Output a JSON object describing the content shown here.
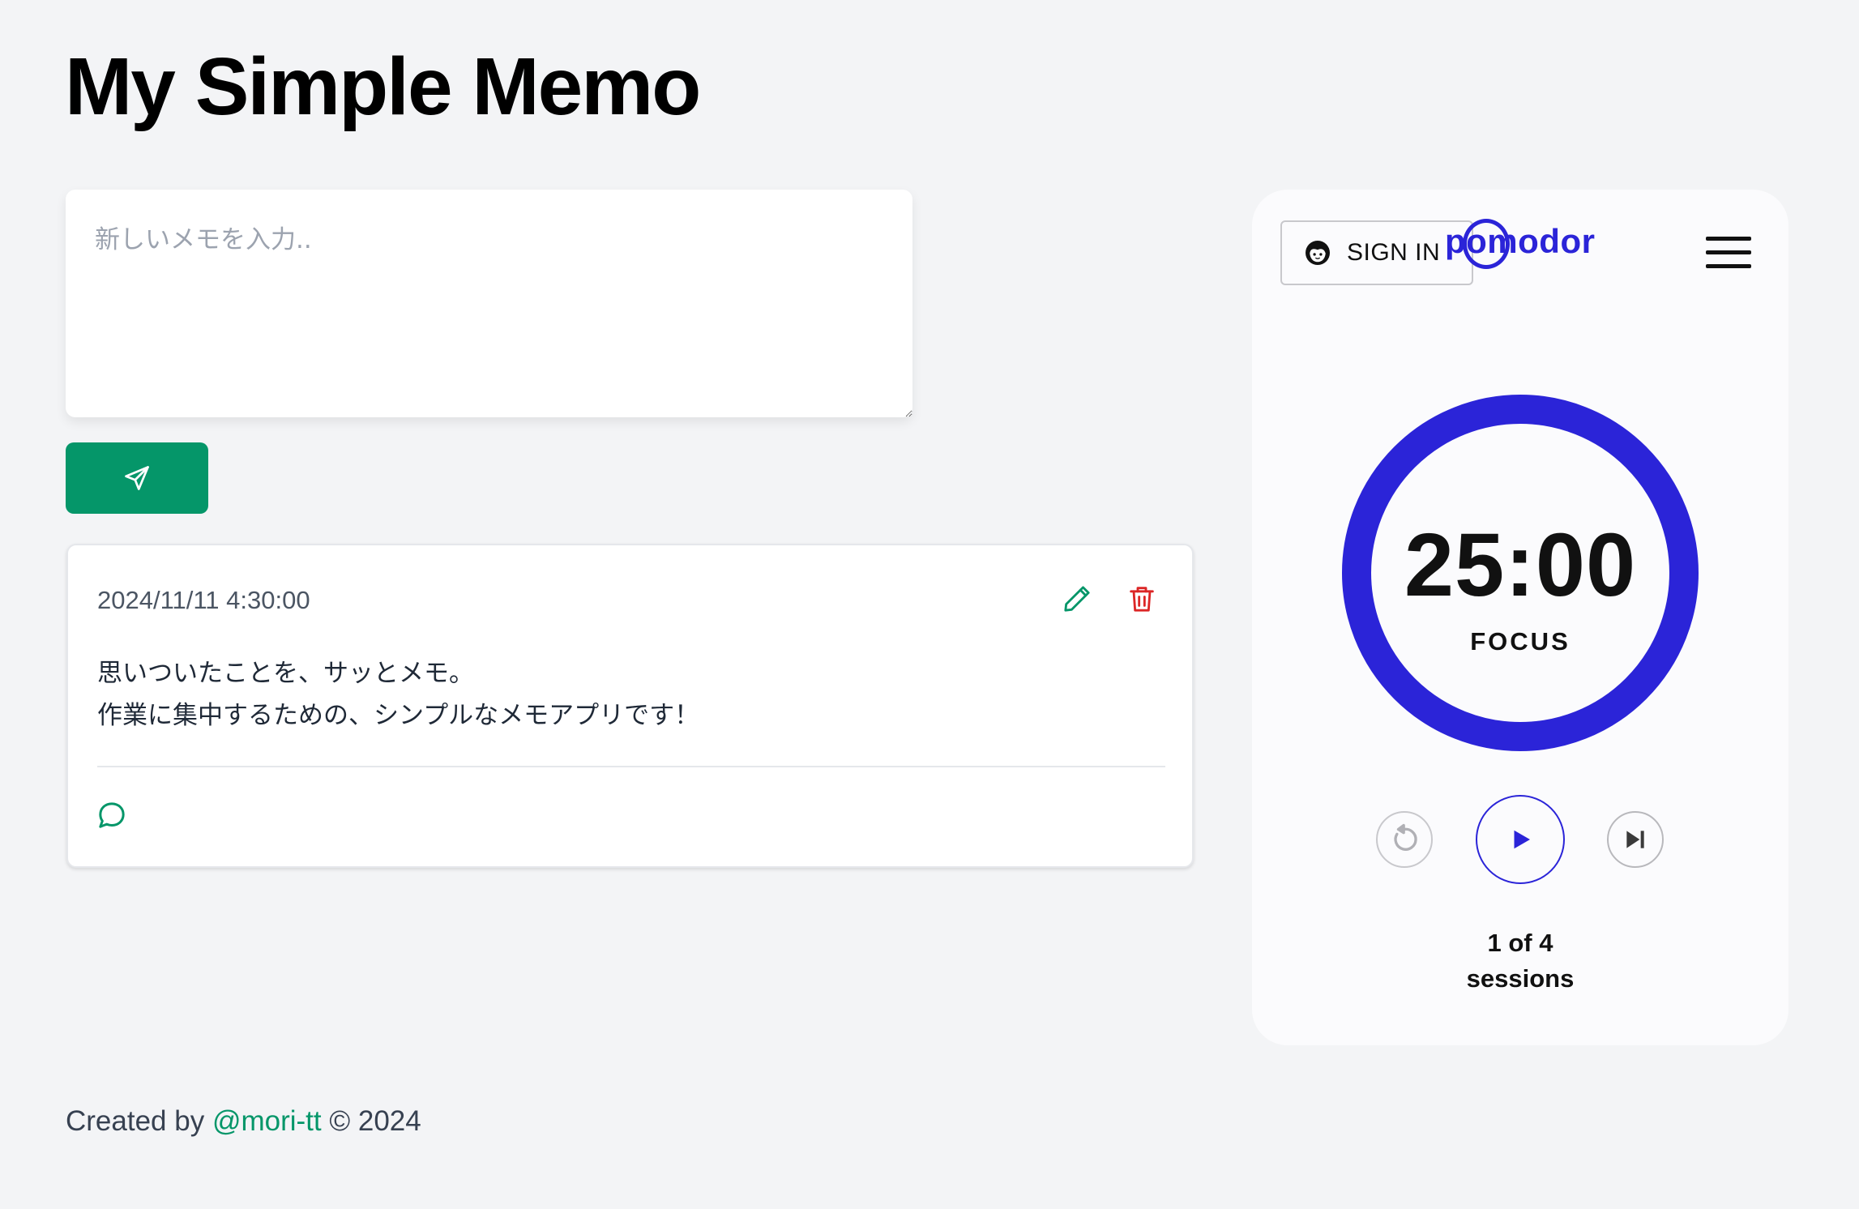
{
  "app": {
    "title": "My Simple Memo"
  },
  "composer": {
    "placeholder": "新しいメモを入力..",
    "value": ""
  },
  "memos": [
    {
      "timestamp": "2024/11/11 4:30:00",
      "lines": [
        "思いついたことを、サッとメモ。",
        "作業に集中するための、シンプルなメモアプリです！"
      ]
    }
  ],
  "pomodoro": {
    "sign_in_label": "SIGN IN",
    "logo": "pomodor",
    "timer": "25:00",
    "mode": "FOCUS",
    "sessions_count": "1 of 4",
    "sessions_label": "sessions",
    "progress": 1.0
  },
  "footer": {
    "prefix": "Created by ",
    "link": "@mori-tt",
    "suffix": " © 2024"
  },
  "colors": {
    "accent": "#059669",
    "danger": "#dc2626",
    "pomo_blue": "#2b24d8",
    "background": "#f3f4f6"
  },
  "icons": {
    "send": "send-icon",
    "edit": "pencil-icon",
    "delete": "trash-icon",
    "comment": "comment-icon",
    "avatar": "user-face-icon",
    "menu": "hamburger-icon",
    "reset": "reset-icon",
    "play": "play-icon",
    "skip": "skip-icon"
  }
}
